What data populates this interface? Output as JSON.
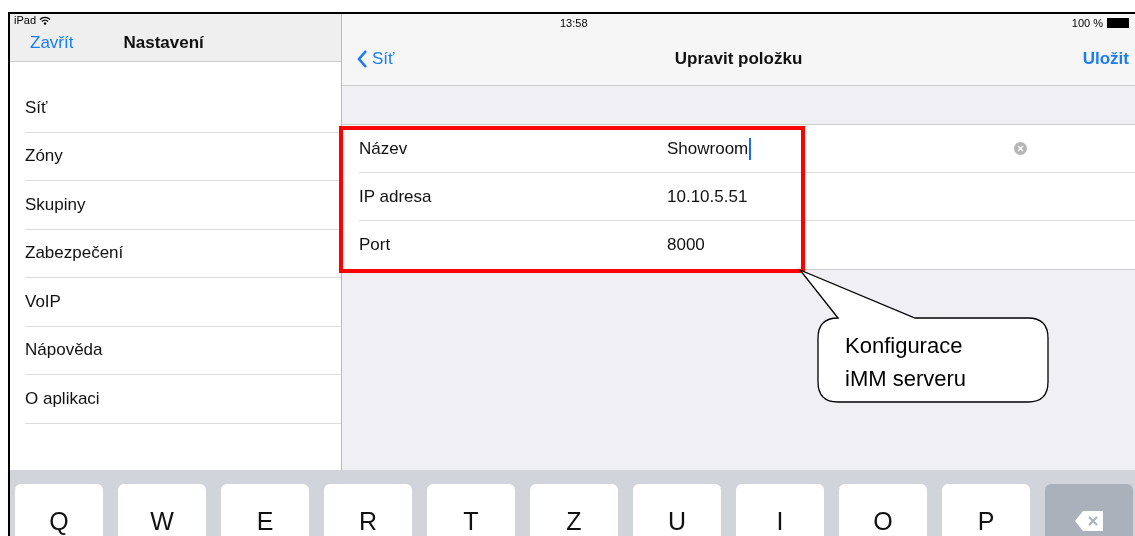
{
  "status_bar": {
    "device": "iPad",
    "time": "13:58",
    "battery": "100 %"
  },
  "sidebar": {
    "close_button": "Zavřít",
    "title": "Nastavení",
    "items": [
      "Síť",
      "Zóny",
      "Skupiny",
      "Zabezpečení",
      "VoIP",
      "Nápověda",
      "O aplikaci"
    ]
  },
  "detail": {
    "back_button": "Síť",
    "title": "Upravit položku",
    "save_button": "Uložit",
    "fields": [
      {
        "label": "Název",
        "value": "Showroom",
        "focused": true
      },
      {
        "label": "IP adresa",
        "value": "10.10.5.51",
        "focused": false
      },
      {
        "label": "Port",
        "value": "8000",
        "focused": false
      }
    ]
  },
  "keyboard": {
    "keys": [
      "Q",
      "W",
      "E",
      "R",
      "T",
      "Z",
      "U",
      "I",
      "O",
      "P"
    ]
  },
  "annotation": {
    "lines": [
      "Konfigurace",
      "iMM serveru"
    ]
  }
}
